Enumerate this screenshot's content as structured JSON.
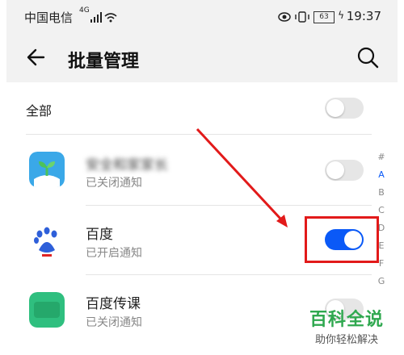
{
  "status": {
    "carrier": "中国电信",
    "network": "4G",
    "battery": "63",
    "time": "19:37"
  },
  "header": {
    "title": "批量管理"
  },
  "all": {
    "label": "全部",
    "enabled": false
  },
  "apps": [
    {
      "name": "安全和家家长",
      "status": "已关闭通知",
      "enabled": false,
      "icon": "sprout-icon"
    },
    {
      "name": "百度",
      "status": "已开启通知",
      "enabled": true,
      "icon": "baidu-paw-icon"
    },
    {
      "name": "百度传课",
      "status": "已关闭通知",
      "enabled": false,
      "icon": "chuanke-icon"
    }
  ],
  "index": [
    "#",
    "A",
    "B",
    "C",
    "D",
    "E",
    "F",
    "G"
  ],
  "watermark": {
    "title": "百科全说",
    "subtitle": "助你轻松解决"
  },
  "colors": {
    "accent": "#0a59f7",
    "highlight": "#e21a1a",
    "watermark": "#2fa84f"
  }
}
